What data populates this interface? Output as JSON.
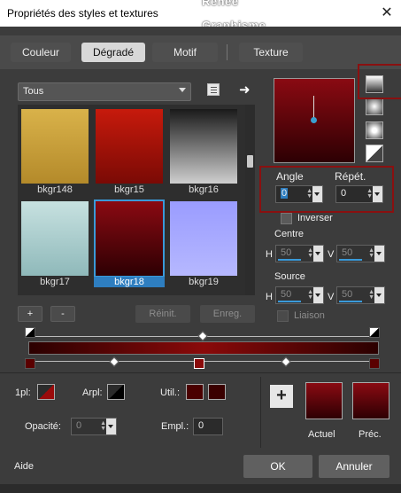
{
  "window": {
    "title": "Propriétés des styles et textures",
    "watermark1": "Renée",
    "watermark2": "Graphisme",
    "close_glyph": "✕"
  },
  "tabs": [
    {
      "label": "Couleur"
    },
    {
      "label": "Dégradé"
    },
    {
      "label": "Motif"
    },
    {
      "label": "Texture"
    }
  ],
  "library": {
    "category": "Tous",
    "arrow_glyph": "➜"
  },
  "swatches": [
    {
      "label": "bkgr148",
      "color_top": "#d9b24a",
      "color_bottom": "#b48a2a"
    },
    {
      "label": "bkgr15",
      "color_top": "#c71a0c",
      "color_bottom": "#7a0a05"
    },
    {
      "label": "bkgr16",
      "color_top": "#1a1a1a",
      "color_bottom": "#cfcfcf"
    },
    {
      "label": "bkgr17",
      "color_top": "#c7e1e0",
      "color_bottom": "#8fb9ba"
    },
    {
      "label": "bkgr18",
      "color_top": "#8a0a12",
      "color_bottom": "#2d0003"
    },
    {
      "label": "bkgr19",
      "color_top": "#9a9cff",
      "color_bottom": "#b6b8ff"
    }
  ],
  "selected_swatch": "bkgr18",
  "lib_buttons": {
    "add": "+",
    "remove": "-",
    "reset": "Réinit.",
    "save": "Enreg."
  },
  "angle": {
    "label": "Angle",
    "value": "0"
  },
  "repeat": {
    "label": "Répét.",
    "value": "0"
  },
  "invert": {
    "label": "Inverser"
  },
  "centre": {
    "label": "Centre",
    "h_label": "H",
    "h_value": "50",
    "v_label": "V",
    "v_value": "50"
  },
  "source": {
    "label": "Source",
    "h_label": "H",
    "h_value": "50",
    "v_label": "V",
    "v_value": "50"
  },
  "link": {
    "label": "Liaison"
  },
  "stops": {
    "fg_label": "1pl:",
    "bg_label": "Arpl:",
    "user_label": "Util.:",
    "opacity_label": "Opacité:",
    "opacity_value": "0",
    "location_label": "Empl.:",
    "location_value": "0",
    "user_color1": "#4a0000",
    "user_color2": "#3a0000"
  },
  "current": {
    "label": "Actuel",
    "plus": "+"
  },
  "previous": {
    "label": "Préc."
  },
  "footer": {
    "help": "Aide",
    "ok": "OK",
    "cancel": "Annuler"
  },
  "colors": {
    "accent": "#2e7ec0",
    "highlight": "#8a1010"
  }
}
